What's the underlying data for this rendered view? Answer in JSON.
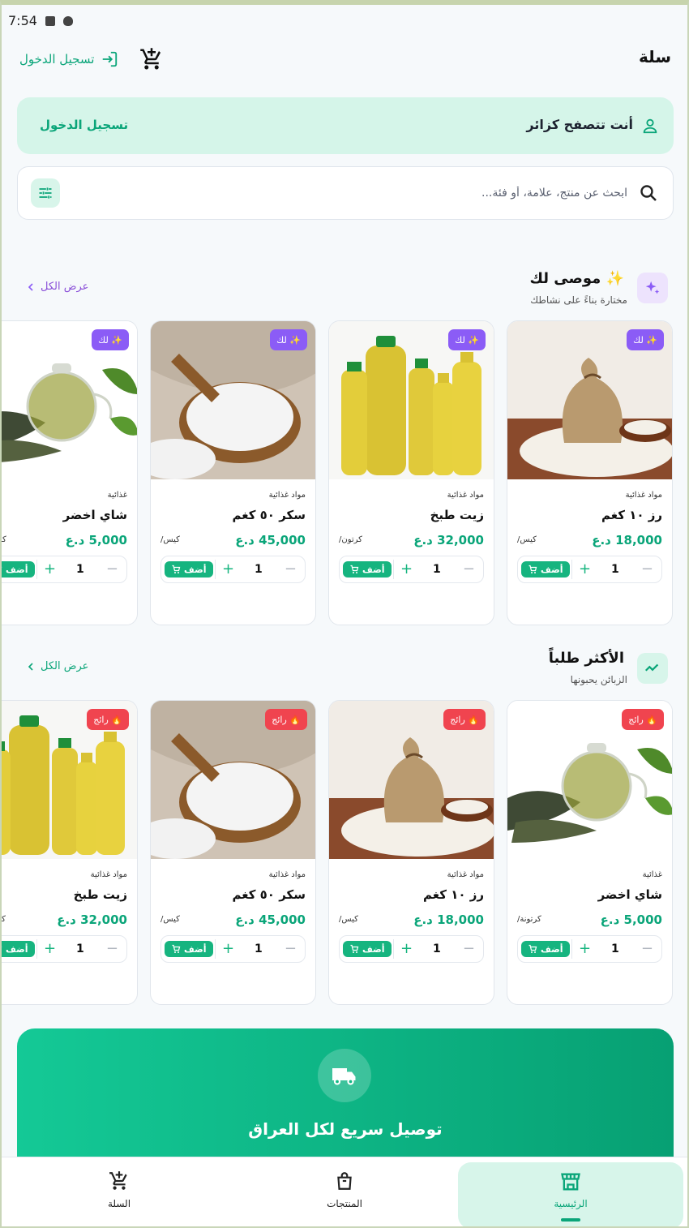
{
  "status_bar": {
    "time": "7:54"
  },
  "header": {
    "title": "سلة",
    "login_label": "تسجيل الدخول"
  },
  "guest_banner": {
    "text": "أنت تتصفح كزائر",
    "login_label": "تسجيل الدخول"
  },
  "search": {
    "placeholder": "ابحث عن منتج، علامة، أو فئة..."
  },
  "recommended": {
    "title": "✨ موصى لك",
    "subtitle": "مختارة بناءً على نشاطك",
    "view_all": "عرض الكل",
    "badge": "✨ لك",
    "products": [
      {
        "category": "مواد غذائية",
        "name": "رز ١٠ كغم",
        "price": "18,000 د.ع",
        "unit": "/كيس",
        "qty": "1",
        "add": "أضف",
        "image": "rice"
      },
      {
        "category": "مواد غذائية",
        "name": "زيت طبخ",
        "price": "32,000 د.ع",
        "unit": "/كرتون",
        "qty": "1",
        "add": "أضف",
        "image": "oil"
      },
      {
        "category": "مواد غذائية",
        "name": "سكر ٥٠ كغم",
        "price": "45,000 د.ع",
        "unit": "/كيس",
        "qty": "1",
        "add": "أضف",
        "image": "sugar"
      },
      {
        "category": "غذائية",
        "name": "شاي اخضر",
        "price": "5,000 د.ع",
        "unit": "/كرتونة",
        "qty": "1",
        "add": "أضف",
        "image": "tea"
      }
    ]
  },
  "popular": {
    "title": "الأكثر طلباً",
    "subtitle": "الزبائن يحبونها",
    "view_all": "عرض الكل",
    "badge": "🔥 رائج",
    "products": [
      {
        "category": "غذائية",
        "name": "شاي اخضر",
        "price": "5,000 د.ع",
        "unit": "/كرتونة",
        "qty": "1",
        "add": "أضف",
        "image": "tea"
      },
      {
        "category": "مواد غذائية",
        "name": "رز ١٠ كغم",
        "price": "18,000 د.ع",
        "unit": "/كيس",
        "qty": "1",
        "add": "أضف",
        "image": "rice"
      },
      {
        "category": "مواد غذائية",
        "name": "سكر ٥٠ كغم",
        "price": "45,000 د.ع",
        "unit": "/كيس",
        "qty": "1",
        "add": "أضف",
        "image": "sugar"
      },
      {
        "category": "مواد غذائية",
        "name": "زيت طبخ",
        "price": "32,000 د.ع",
        "unit": "/كرتون",
        "qty": "1",
        "add": "أضف",
        "image": "oil"
      }
    ]
  },
  "delivery_banner": {
    "title": "توصيل سريع لكل العراق"
  },
  "bottom_nav": [
    {
      "label": "الرئيسية",
      "icon": "store-icon",
      "active": true
    },
    {
      "label": "المنتجات",
      "icon": "bag-icon",
      "active": false
    },
    {
      "label": "السلة",
      "icon": "cart-icon",
      "active": false
    }
  ],
  "colors": {
    "accent": "#0aa579",
    "recommend": "#8b5cf6",
    "hot": "#f0444f"
  }
}
